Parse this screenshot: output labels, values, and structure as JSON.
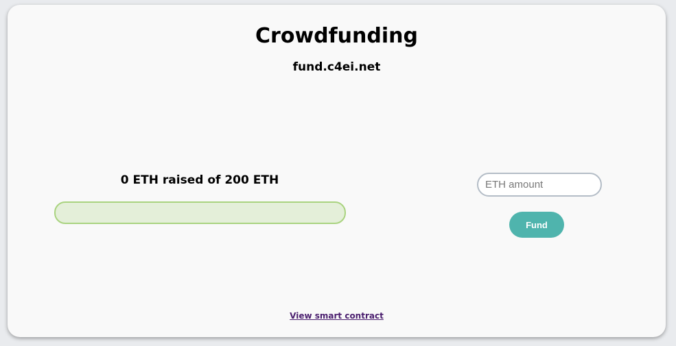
{
  "page": {
    "title": "Crowdfunding",
    "subtitle": "fund.c4ei.net"
  },
  "campaign": {
    "raised_amount": "0",
    "raised_middle": " ETH raised of ",
    "goal_amount": "200",
    "raised_suffix": " ETH",
    "progress_fraction": 0
  },
  "fund_form": {
    "amount_placeholder": "ETH amount",
    "amount_value": "",
    "fund_label": "Fund"
  },
  "footer": {
    "contract_link_label": "View smart contract"
  },
  "colors": {
    "accent": "#4fb4ad",
    "progress_border": "#a9d37f",
    "progress_track": "#e4efd9",
    "link": "#4b1f6f"
  }
}
